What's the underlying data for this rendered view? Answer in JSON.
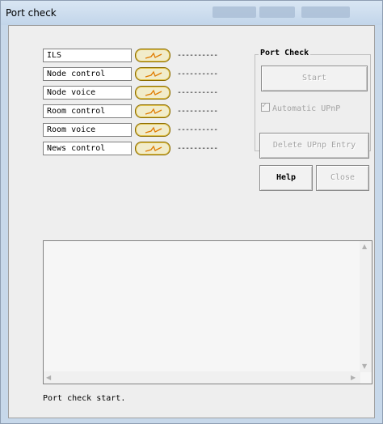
{
  "window": {
    "title": "Port check"
  },
  "ports": [
    {
      "label": "ILS",
      "status": "----------"
    },
    {
      "label": "Node control",
      "status": "----------"
    },
    {
      "label": "Node voice",
      "status": "----------"
    },
    {
      "label": "Room control",
      "status": "----------"
    },
    {
      "label": "Room voice",
      "status": "----------"
    },
    {
      "label": "News control",
      "status": "----------"
    }
  ],
  "port_check_group": {
    "title": "Port Check",
    "start_label": "Start",
    "auto_upnp_label": "Automatic UPnP",
    "auto_upnp_checked": true
  },
  "buttons": {
    "delete_upnp": "Delete UPnp Entry",
    "help": "Help",
    "close": "Close"
  },
  "log": {
    "lines": []
  },
  "status": {
    "text": "Port check start."
  },
  "colors": {
    "indicator_fill": "#f1eccb",
    "indicator_border": "#8a6b00",
    "indicator_icon": "#e07b00"
  }
}
